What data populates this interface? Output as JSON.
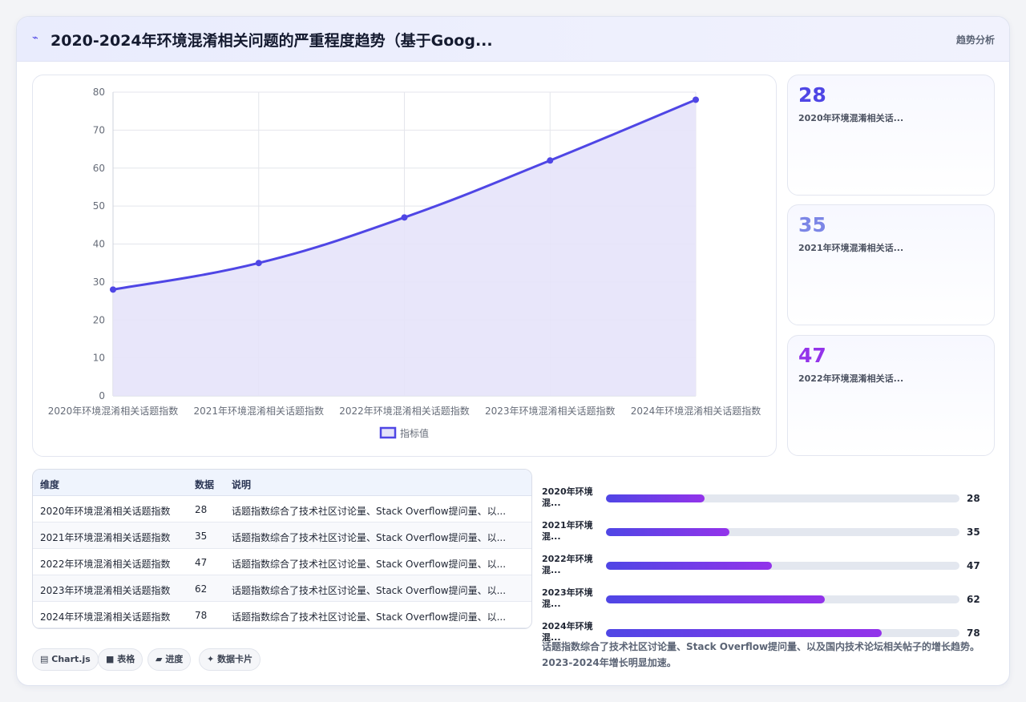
{
  "header": {
    "icon": "trend-line-icon",
    "title": "2020-2024年环境混淆相关问题的严重程度趋势（基于Goog...",
    "action": "趋势分析"
  },
  "colors": {
    "accent": "#4f46e5",
    "accent2": "#9333ea",
    "area": "#e5e3f9"
  },
  "chart_data": {
    "type": "line",
    "title": "",
    "xlabel": "",
    "ylabel": "",
    "categories": [
      "2020年环境混淆相关话题指数",
      "2021年环境混淆相关话题指数",
      "2022年环境混淆相关话题指数",
      "2023年环境混淆相关话题指数",
      "2024年环境混淆相关话题指数"
    ],
    "series": [
      {
        "name": "指标值",
        "values": [
          28,
          35,
          47,
          62,
          78
        ]
      }
    ],
    "ylim": [
      0,
      80
    ],
    "yticks": [
      0,
      10,
      20,
      30,
      40,
      50,
      60,
      70,
      80
    ],
    "grid": true,
    "legend": "bottom",
    "fill": true
  },
  "stat_cards": [
    {
      "value": "28",
      "label": "2020年环境混淆相关话...",
      "color": "#4f46e5"
    },
    {
      "value": "35",
      "label": "2021年环境混淆相关话...",
      "color": "#7c86e6"
    },
    {
      "value": "47",
      "label": "2022年环境混淆相关话...",
      "color": "#9333ea"
    }
  ],
  "table": {
    "headers": [
      "维度",
      "数据",
      "说明"
    ],
    "rows": [
      [
        "2020年环境混淆相关话题指数",
        "28",
        "话题指数综合了技术社区讨论量、Stack Overflow提问量、以..."
      ],
      [
        "2021年环境混淆相关话题指数",
        "35",
        "话题指数综合了技术社区讨论量、Stack Overflow提问量、以..."
      ],
      [
        "2022年环境混淆相关话题指数",
        "47",
        "话题指数综合了技术社区讨论量、Stack Overflow提问量、以..."
      ],
      [
        "2023年环境混淆相关话题指数",
        "62",
        "话题指数综合了技术社区讨论量、Stack Overflow提问量、以..."
      ],
      [
        "2024年环境混淆相关话题指数",
        "78",
        "话题指数综合了技术社区讨论量、Stack Overflow提问量、以..."
      ]
    ]
  },
  "progress": {
    "max": 100,
    "items": [
      {
        "label": "2020年环境混...",
        "value": 28
      },
      {
        "label": "2021年环境混...",
        "value": 35
      },
      {
        "label": "2022年环境混...",
        "value": 47
      },
      {
        "label": "2023年环境混...",
        "value": 62
      },
      {
        "label": "2024年环境混...",
        "value": 78
      }
    ]
  },
  "note": "话题指数综合了技术社区讨论量、Stack Overflow提问量、以及国内技术论坛相关帖子的增长趋势。2023-2024年增长明显加速。",
  "tags": [
    {
      "icon": "chart-icon",
      "glyph": "▤",
      "label": "Chart.js"
    },
    {
      "icon": "table-icon",
      "glyph": "■",
      "label": "表格"
    },
    {
      "icon": "progress-icon",
      "glyph": "▰",
      "label": "进度"
    },
    {
      "icon": "sparkle-icon",
      "glyph": "✦",
      "label": "数据卡片"
    }
  ]
}
